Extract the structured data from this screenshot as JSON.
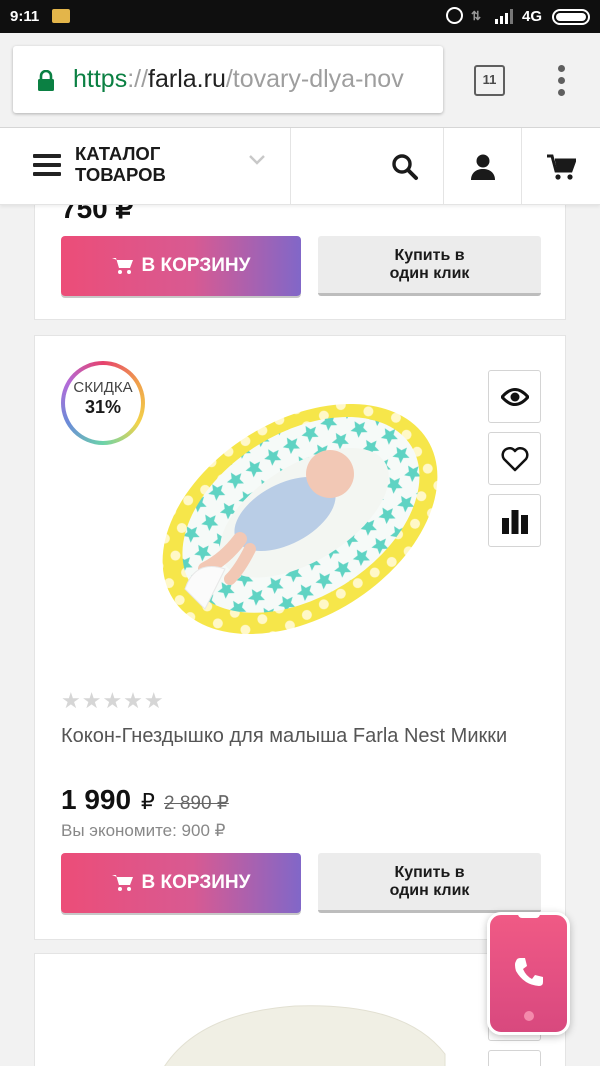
{
  "status_bar": {
    "time": "9:11",
    "network": "4G"
  },
  "browser": {
    "url_scheme": "https",
    "url_sep": "://",
    "url_domain": "farla.ru",
    "url_path": "/tovary-dlya-nov",
    "tab_count": "11"
  },
  "header": {
    "catalog_label": "КАТАЛОГ\nТОВАРОВ",
    "icons": [
      "menu-icon",
      "chevron-down-icon",
      "search-icon",
      "user-icon",
      "cart-icon"
    ]
  },
  "previous_product": {
    "price_partial": "750 ₽",
    "add_to_cart": "В КОРЗИНУ",
    "one_click": "Купить в\nодин клик"
  },
  "product": {
    "discount_label": "СКИДКА",
    "discount_value": "31%",
    "rating": "★★★★★",
    "name": "Кокон-Гнездышко для малыша Farla Nest Микки",
    "price": "1 990",
    "currency": "₽",
    "old_price": "2 890 ₽",
    "savings": "Вы экономите: 900 ₽",
    "add_to_cart": "В КОРЗИНУ",
    "one_click": "Купить в\nодин клик"
  },
  "colors": {
    "accent_pink": "#ec4d78",
    "accent_purple": "#8167c8",
    "call_widget": "#e24f82"
  }
}
